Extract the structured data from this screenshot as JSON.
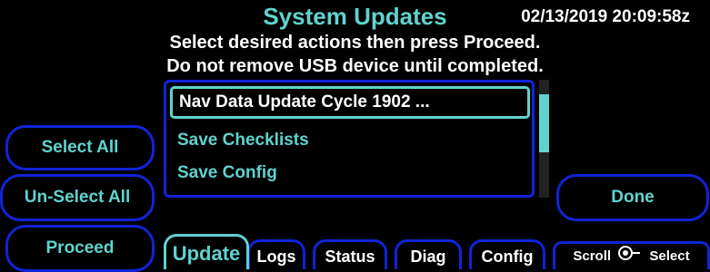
{
  "header": {
    "title": "System Updates",
    "timestamp": "02/13/2019 20:09:58z",
    "instruction_line1": "Select desired actions then press Proceed.",
    "instruction_line2": "Do not remove USB device until completed."
  },
  "list": {
    "items": [
      {
        "label": "Nav Data Update Cycle 1902 ...",
        "selected": true
      },
      {
        "label": "Save Checklists",
        "selected": false
      },
      {
        "label": "Save Config",
        "selected": false
      }
    ]
  },
  "buttons": {
    "select_all": "Select All",
    "unselect_all": "Un-Select All",
    "proceed": "Proceed",
    "done": "Done"
  },
  "tabs": [
    {
      "label": "Update",
      "active": true
    },
    {
      "label": "Logs",
      "active": false
    },
    {
      "label": "Status",
      "active": false
    },
    {
      "label": "Diag",
      "active": false
    },
    {
      "label": "Config",
      "active": false
    }
  ],
  "scroll_hint": {
    "scroll_label": "Scroll",
    "select_label": "Select",
    "icon": "knob-icon"
  },
  "colors": {
    "accent": "#5fd3cf",
    "border": "#1024d8",
    "background": "#000000",
    "text": "#ffffff"
  }
}
